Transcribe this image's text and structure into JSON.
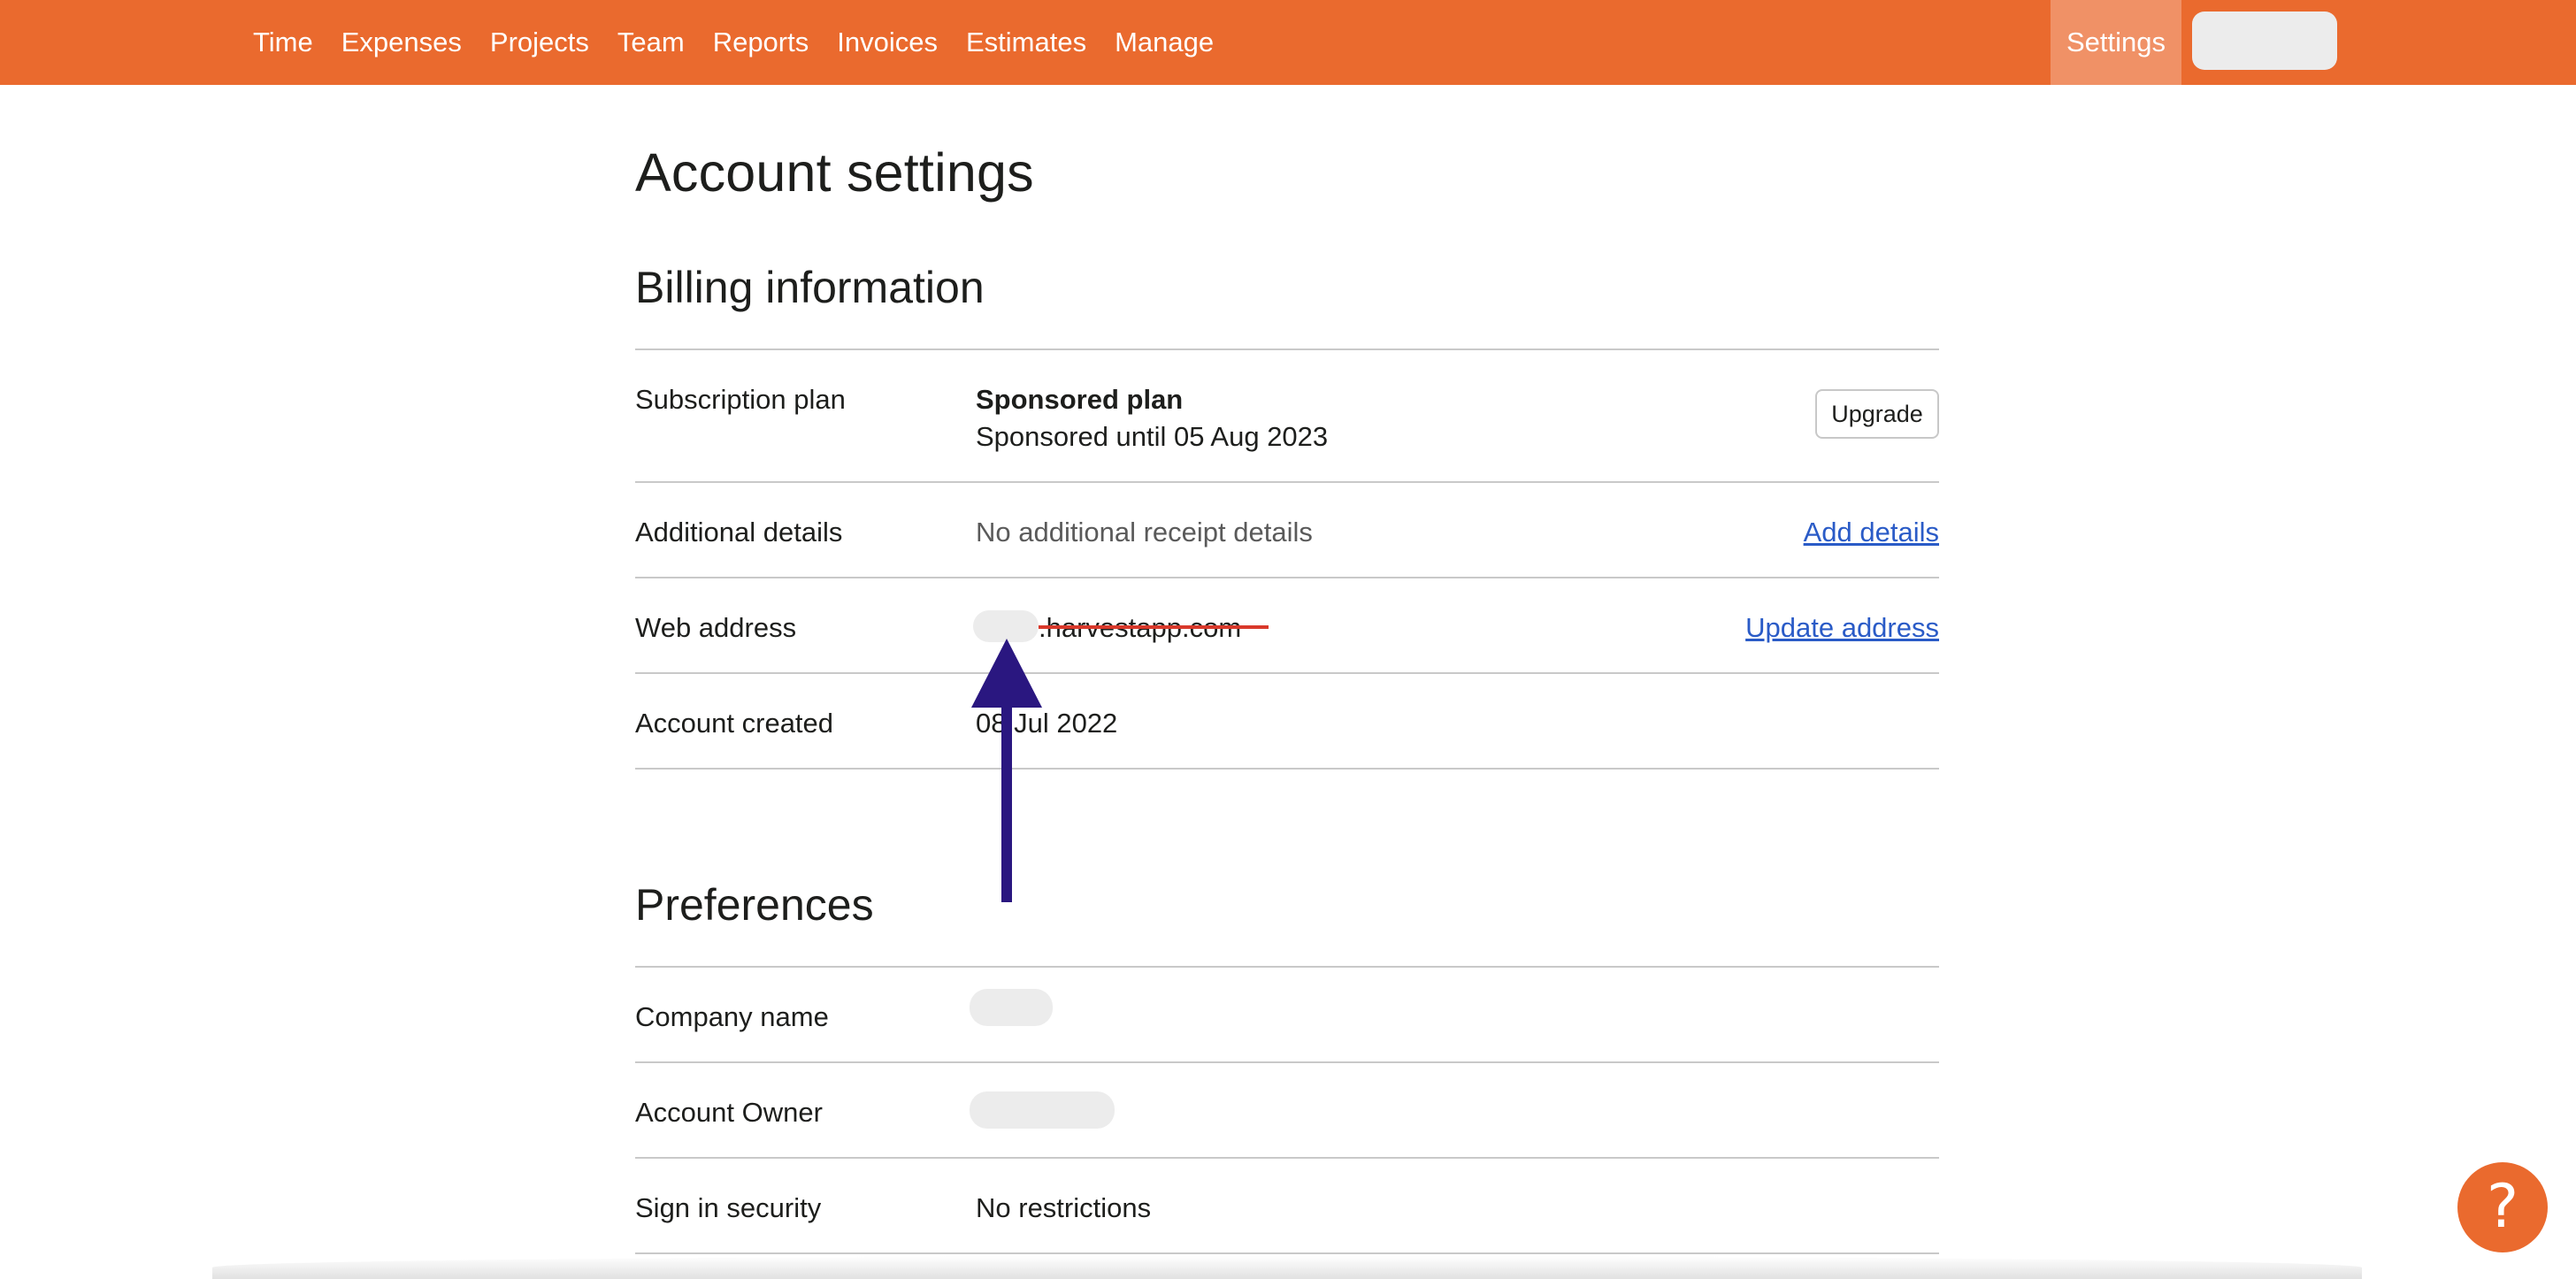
{
  "nav": {
    "links": [
      "Time",
      "Expenses",
      "Projects",
      "Team",
      "Reports",
      "Invoices",
      "Estimates",
      "Manage"
    ],
    "settings": "Settings"
  },
  "page": {
    "title": "Account settings"
  },
  "billing": {
    "title": "Billing information",
    "subscription": {
      "label": "Subscription plan",
      "plan": "Sponsored plan",
      "detail": "Sponsored until 05 Aug 2023",
      "button": "Upgrade"
    },
    "additional": {
      "label": "Additional details",
      "value": "No additional receipt details",
      "link": "Add details"
    },
    "web": {
      "label": "Web address",
      "domain": ".harvestapp.com",
      "link": "Update address"
    },
    "created": {
      "label": "Account created",
      "value": "08 Jul 2022"
    }
  },
  "preferences": {
    "title": "Preferences",
    "company": {
      "label": "Company name"
    },
    "owner": {
      "label": "Account Owner"
    },
    "security": {
      "label": "Sign in security",
      "value": "No restrictions"
    }
  },
  "help": {
    "icon": "question-mark-icon",
    "glyph": "?"
  },
  "colors": {
    "brand": "#ea6a2e",
    "nav_active": "#f09166",
    "link": "#2a5bc7",
    "annotation_arrow": "#2a1780",
    "annotation_strike": "#d9392b"
  }
}
